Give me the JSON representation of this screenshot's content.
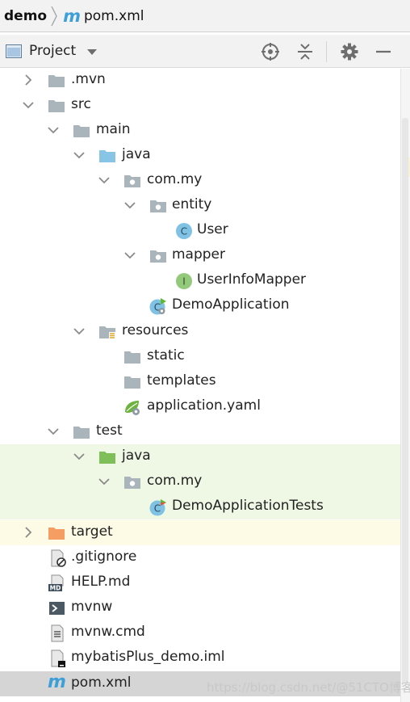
{
  "breadcrumb": {
    "root": "demo",
    "file": "pom.xml",
    "file_icon": "m"
  },
  "toolwindow": {
    "title": "Project"
  },
  "tree": [
    {
      "label": ".mvn",
      "icon": "folder",
      "arrow": "right"
    },
    {
      "label": "src",
      "icon": "folder",
      "arrow": "down"
    },
    {
      "label": "main",
      "icon": "folder",
      "arrow": "down"
    },
    {
      "label": "java",
      "icon": "folder-source",
      "arrow": "down"
    },
    {
      "label": "com.my",
      "icon": "package",
      "arrow": "down"
    },
    {
      "label": "entity",
      "icon": "package",
      "arrow": "down"
    },
    {
      "label": "User",
      "icon": "class",
      "arrow": "none",
      "badge": "C"
    },
    {
      "label": "mapper",
      "icon": "package",
      "arrow": "down"
    },
    {
      "label": "UserInfoMapper",
      "icon": "interface",
      "arrow": "none",
      "badge": "I"
    },
    {
      "label": "DemoApplication",
      "icon": "spring-class",
      "arrow": "none",
      "badge": "C"
    },
    {
      "label": "resources",
      "icon": "resources-folder",
      "arrow": "down"
    },
    {
      "label": "static",
      "icon": "folder",
      "arrow": "none"
    },
    {
      "label": "templates",
      "icon": "folder",
      "arrow": "none"
    },
    {
      "label": "application.yaml",
      "icon": "spring-config",
      "arrow": "none"
    },
    {
      "label": "test",
      "icon": "folder",
      "arrow": "down"
    },
    {
      "label": "java",
      "icon": "folder-test",
      "arrow": "down"
    },
    {
      "label": "com.my",
      "icon": "package",
      "arrow": "down"
    },
    {
      "label": "DemoApplicationTests",
      "icon": "test-class",
      "arrow": "none",
      "badge": "C"
    },
    {
      "label": "target",
      "icon": "folder-excluded",
      "arrow": "right"
    },
    {
      "label": ".gitignore",
      "icon": "ignored-file",
      "arrow": "none"
    },
    {
      "label": "HELP.md",
      "icon": "markdown-file",
      "arrow": "none",
      "badge": "MD"
    },
    {
      "label": "mvnw",
      "icon": "shell-file",
      "arrow": "none"
    },
    {
      "label": "mvnw.cmd",
      "icon": "text-file",
      "arrow": "none"
    },
    {
      "label": "mybatisPlus_demo.iml",
      "icon": "module-file",
      "arrow": "none"
    },
    {
      "label": "pom.xml",
      "icon": "maven-file",
      "arrow": "none",
      "badge": "m"
    }
  ],
  "watermark": "https://blog.csdn.net/@51CTO博客",
  "colors": {
    "folder": "#a9b4bb",
    "source_folder": "#87c4e6",
    "test_folder": "#7fbf5a",
    "excluded_folder": "#f59d63",
    "class_badge": "#7fc2e4",
    "interface_badge": "#93c97b",
    "test_row_bg": "#eff8e5",
    "target_row_bg": "#fdfbe6",
    "selected_row_bg": "#d5d5d5",
    "maven_blue": "#3d9fd8"
  }
}
